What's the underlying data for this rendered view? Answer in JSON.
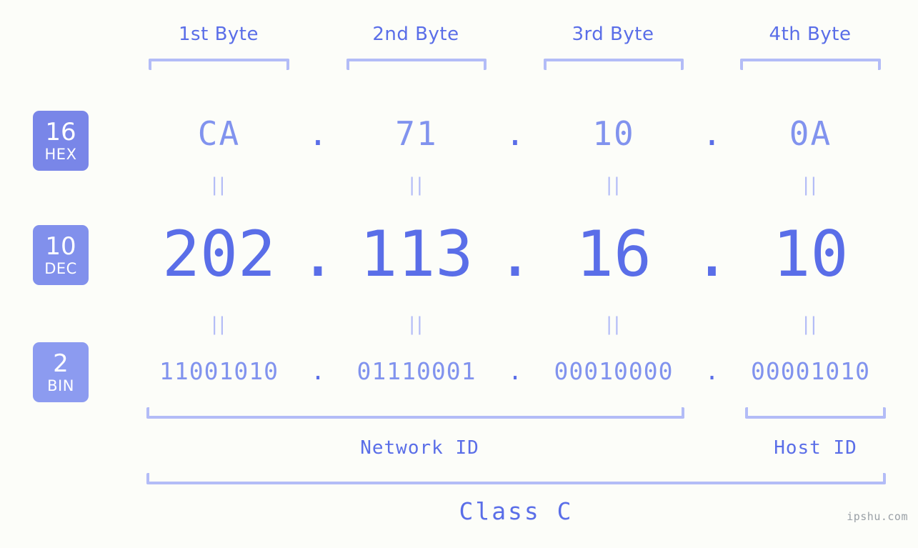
{
  "background_color": "#fcfdf9",
  "colors": {
    "primary_blue": "#5a6ee8",
    "light_blue": "#8193ee",
    "bracket_blue": "#b3bcf7",
    "badge_hex": "#7986e8",
    "badge_dec": "#8190ec",
    "badge_bin": "#8c9bf0",
    "watermark_gray": "#9aa0a6"
  },
  "byte_headers": [
    {
      "label": "1st Byte"
    },
    {
      "label": "2nd Byte"
    },
    {
      "label": "3rd Byte"
    },
    {
      "label": "4th Byte"
    }
  ],
  "badges": [
    {
      "num": "16",
      "abbr": "HEX",
      "color": "#7986e8"
    },
    {
      "num": "10",
      "abbr": "DEC",
      "color": "#8190ec"
    },
    {
      "num": "2",
      "abbr": "BIN",
      "color": "#8c9bf0"
    }
  ],
  "rows": {
    "hex": {
      "values": [
        "CA",
        "71",
        "10",
        "0A"
      ],
      "separator": "."
    },
    "dec": {
      "values": [
        "202",
        "113",
        "16",
        "10"
      ],
      "separator": "."
    },
    "bin": {
      "values": [
        "11001010",
        "01110001",
        "00010000",
        "00001010"
      ],
      "separator": "."
    }
  },
  "equals_marker": "||",
  "sections": {
    "network_id_label": "Network ID",
    "host_id_label": "Host ID",
    "class_label": "Class C"
  },
  "watermark": "ipshu.com"
}
